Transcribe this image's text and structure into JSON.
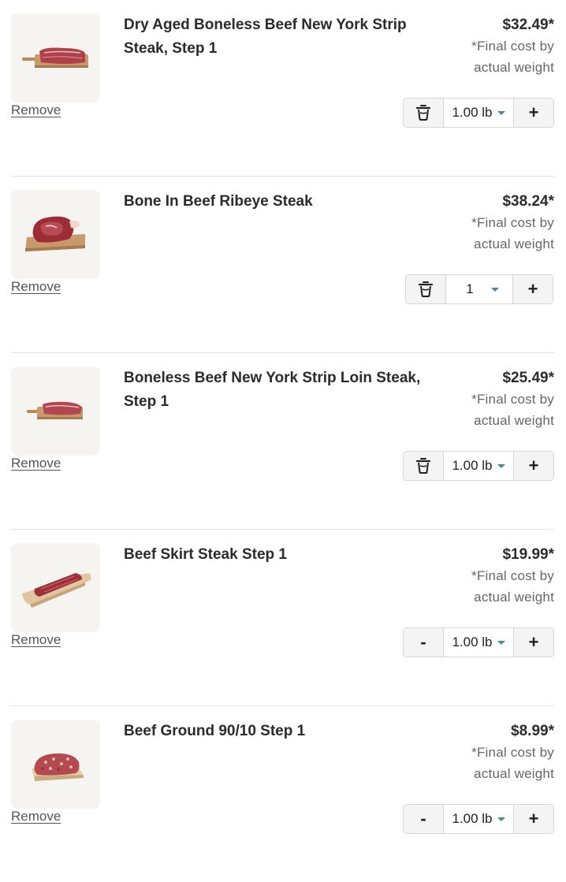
{
  "items": [
    {
      "name": "Dry Aged Boneless Beef New York Strip Steak, Step 1",
      "price": "$32.49*",
      "price_note": "*Final cost by actual weight",
      "remove_label": "Remove",
      "quantity": "1.00 lb",
      "left_control": "trash-icon",
      "image": "strip-steak-on-board"
    },
    {
      "name": "Bone In Beef Ribeye Steak",
      "price": "$38.24*",
      "price_note": "*Final cost by actual weight",
      "remove_label": "Remove",
      "quantity": "1",
      "left_control": "trash-icon",
      "image": "ribeye-on-board"
    },
    {
      "name": "Boneless Beef New York Strip Loin Steak, Step 1",
      "price": "$25.49*",
      "price_note": "*Final cost by actual weight",
      "remove_label": "Remove",
      "quantity": "1.00 lb",
      "left_control": "trash-icon",
      "image": "strip-loin-on-board"
    },
    {
      "name": "Beef Skirt Steak Step 1",
      "price": "$19.99*",
      "price_note": "*Final cost by actual weight",
      "remove_label": "Remove",
      "quantity": "1.00 lb",
      "left_control": "-",
      "image": "skirt-steak-on-board"
    },
    {
      "name": "Beef Ground 90/10 Step 1",
      "price": "$8.99*",
      "price_note": "*Final cost by actual weight",
      "remove_label": "Remove",
      "quantity": "1.00 lb",
      "left_control": "-",
      "image": "ground-beef-tray"
    }
  ],
  "increment_label": "+",
  "colors": {
    "caret": "#3d8f9a",
    "thumb_bg": "#f6f4f1",
    "board": "#c49464",
    "meat": "#a8323c"
  }
}
